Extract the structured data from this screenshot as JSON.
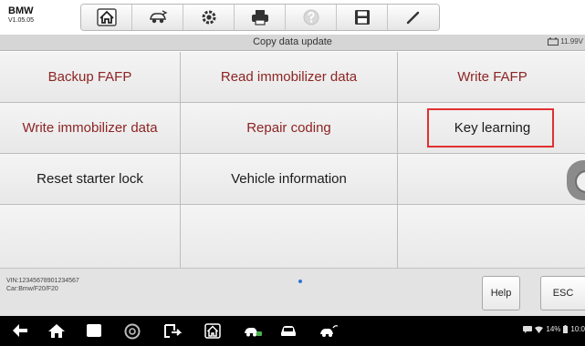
{
  "device": {
    "brand": "BMW",
    "version": "V1.05.05"
  },
  "toolbar": {
    "icons": [
      "home-icon",
      "vehicle-swap-icon",
      "settings-icon",
      "print-icon",
      "help-circle-icon",
      "save-icon",
      "pen-icon"
    ]
  },
  "title": "Copy data update",
  "battery_voltage": "11.99V",
  "functions": {
    "backup_fafp": "Backup FAFP",
    "read_immobilizer": "Read immobilizer data",
    "write_fafp": "Write FAFP",
    "write_immobilizer": "Write immobilizer data",
    "repair_coding": "Repair coding",
    "key_learning": "Key learning",
    "reset_starter_lock": "Reset starter lock",
    "vehicle_information": "Vehicle information"
  },
  "vehicle": {
    "vin": "VIN:12345678901234567",
    "car": "Car:Bmw/F20/F20"
  },
  "buttons": {
    "help": "Help",
    "esc": "ESC"
  },
  "status_bar": {
    "battery_percent": "14%",
    "time": "10:0"
  },
  "colors": {
    "red_label": "#8e2424",
    "highlight": "#e23030",
    "accent_dot": "#2e74d6"
  }
}
